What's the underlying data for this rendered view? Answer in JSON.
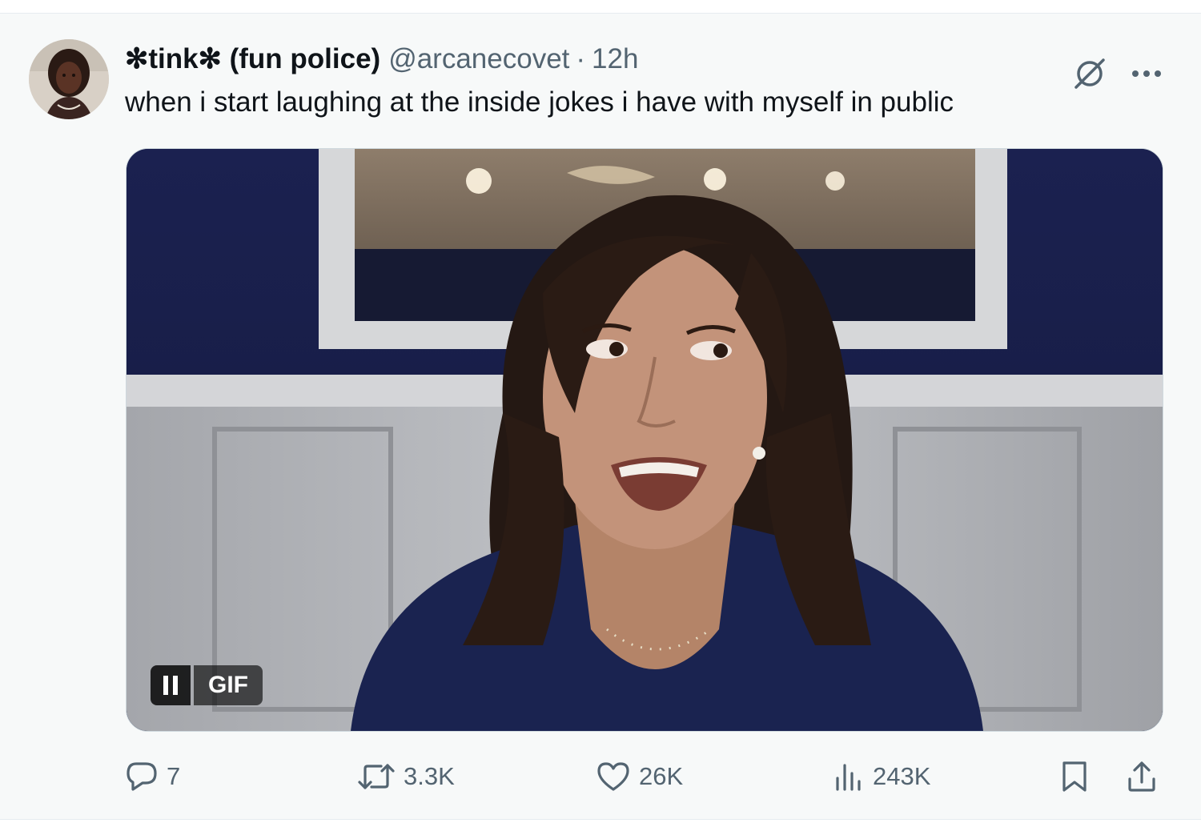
{
  "tweet": {
    "display_name": "✻tink✻ (fun police)",
    "handle": "@arcanecovet",
    "separator": "·",
    "time": "12h",
    "text": "when i start laughing at the inside jokes i have with myself in public",
    "avatar_icon": "user-avatar-photo",
    "grok_icon": "grok-icon",
    "more_icon": "more-dots-icon"
  },
  "media": {
    "type": "gif",
    "gif_badge": "GIF",
    "pause_icon": "pause-icon"
  },
  "actions": {
    "reply": {
      "icon": "reply-icon",
      "count": "7"
    },
    "retweet": {
      "icon": "retweet-icon",
      "count": "3.3K"
    },
    "like": {
      "icon": "heart-icon",
      "count": "26K"
    },
    "views": {
      "icon": "views-chart-icon",
      "count": "243K"
    },
    "bookmark": {
      "icon": "bookmark-icon"
    },
    "share": {
      "icon": "share-icon"
    }
  },
  "colors": {
    "text_primary": "#0f1419",
    "text_secondary": "#536471",
    "background": "#f7f9f9"
  }
}
